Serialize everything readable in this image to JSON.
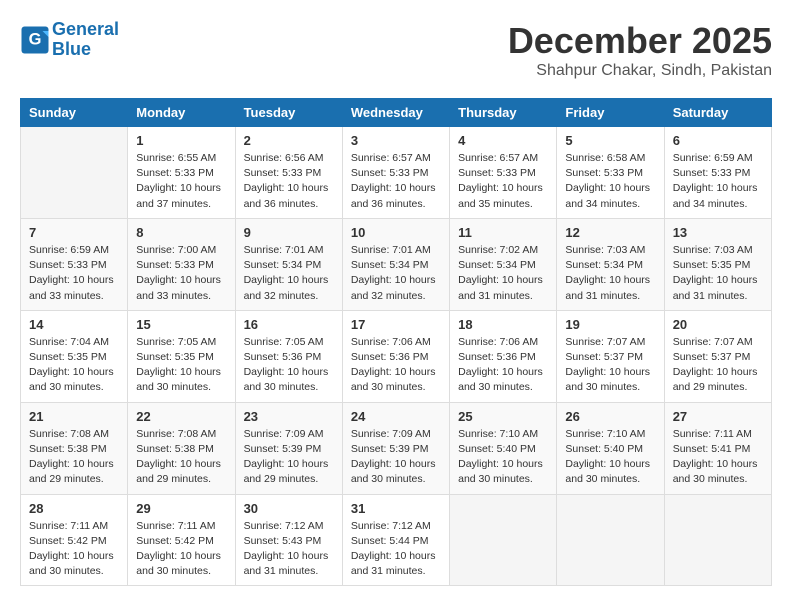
{
  "logo": {
    "line1": "General",
    "line2": "Blue"
  },
  "title": "December 2025",
  "subtitle": "Shahpur Chakar, Sindh, Pakistan",
  "days_header": [
    "Sunday",
    "Monday",
    "Tuesday",
    "Wednesday",
    "Thursday",
    "Friday",
    "Saturday"
  ],
  "weeks": [
    [
      {
        "day": "",
        "info": ""
      },
      {
        "day": "1",
        "info": "Sunrise: 6:55 AM\nSunset: 5:33 PM\nDaylight: 10 hours\nand 37 minutes."
      },
      {
        "day": "2",
        "info": "Sunrise: 6:56 AM\nSunset: 5:33 PM\nDaylight: 10 hours\nand 36 minutes."
      },
      {
        "day": "3",
        "info": "Sunrise: 6:57 AM\nSunset: 5:33 PM\nDaylight: 10 hours\nand 36 minutes."
      },
      {
        "day": "4",
        "info": "Sunrise: 6:57 AM\nSunset: 5:33 PM\nDaylight: 10 hours\nand 35 minutes."
      },
      {
        "day": "5",
        "info": "Sunrise: 6:58 AM\nSunset: 5:33 PM\nDaylight: 10 hours\nand 34 minutes."
      },
      {
        "day": "6",
        "info": "Sunrise: 6:59 AM\nSunset: 5:33 PM\nDaylight: 10 hours\nand 34 minutes."
      }
    ],
    [
      {
        "day": "7",
        "info": "Sunrise: 6:59 AM\nSunset: 5:33 PM\nDaylight: 10 hours\nand 33 minutes."
      },
      {
        "day": "8",
        "info": "Sunrise: 7:00 AM\nSunset: 5:33 PM\nDaylight: 10 hours\nand 33 minutes."
      },
      {
        "day": "9",
        "info": "Sunrise: 7:01 AM\nSunset: 5:34 PM\nDaylight: 10 hours\nand 32 minutes."
      },
      {
        "day": "10",
        "info": "Sunrise: 7:01 AM\nSunset: 5:34 PM\nDaylight: 10 hours\nand 32 minutes."
      },
      {
        "day": "11",
        "info": "Sunrise: 7:02 AM\nSunset: 5:34 PM\nDaylight: 10 hours\nand 31 minutes."
      },
      {
        "day": "12",
        "info": "Sunrise: 7:03 AM\nSunset: 5:34 PM\nDaylight: 10 hours\nand 31 minutes."
      },
      {
        "day": "13",
        "info": "Sunrise: 7:03 AM\nSunset: 5:35 PM\nDaylight: 10 hours\nand 31 minutes."
      }
    ],
    [
      {
        "day": "14",
        "info": "Sunrise: 7:04 AM\nSunset: 5:35 PM\nDaylight: 10 hours\nand 30 minutes."
      },
      {
        "day": "15",
        "info": "Sunrise: 7:05 AM\nSunset: 5:35 PM\nDaylight: 10 hours\nand 30 minutes."
      },
      {
        "day": "16",
        "info": "Sunrise: 7:05 AM\nSunset: 5:36 PM\nDaylight: 10 hours\nand 30 minutes."
      },
      {
        "day": "17",
        "info": "Sunrise: 7:06 AM\nSunset: 5:36 PM\nDaylight: 10 hours\nand 30 minutes."
      },
      {
        "day": "18",
        "info": "Sunrise: 7:06 AM\nSunset: 5:36 PM\nDaylight: 10 hours\nand 30 minutes."
      },
      {
        "day": "19",
        "info": "Sunrise: 7:07 AM\nSunset: 5:37 PM\nDaylight: 10 hours\nand 30 minutes."
      },
      {
        "day": "20",
        "info": "Sunrise: 7:07 AM\nSunset: 5:37 PM\nDaylight: 10 hours\nand 29 minutes."
      }
    ],
    [
      {
        "day": "21",
        "info": "Sunrise: 7:08 AM\nSunset: 5:38 PM\nDaylight: 10 hours\nand 29 minutes."
      },
      {
        "day": "22",
        "info": "Sunrise: 7:08 AM\nSunset: 5:38 PM\nDaylight: 10 hours\nand 29 minutes."
      },
      {
        "day": "23",
        "info": "Sunrise: 7:09 AM\nSunset: 5:39 PM\nDaylight: 10 hours\nand 29 minutes."
      },
      {
        "day": "24",
        "info": "Sunrise: 7:09 AM\nSunset: 5:39 PM\nDaylight: 10 hours\nand 30 minutes."
      },
      {
        "day": "25",
        "info": "Sunrise: 7:10 AM\nSunset: 5:40 PM\nDaylight: 10 hours\nand 30 minutes."
      },
      {
        "day": "26",
        "info": "Sunrise: 7:10 AM\nSunset: 5:40 PM\nDaylight: 10 hours\nand 30 minutes."
      },
      {
        "day": "27",
        "info": "Sunrise: 7:11 AM\nSunset: 5:41 PM\nDaylight: 10 hours\nand 30 minutes."
      }
    ],
    [
      {
        "day": "28",
        "info": "Sunrise: 7:11 AM\nSunset: 5:42 PM\nDaylight: 10 hours\nand 30 minutes."
      },
      {
        "day": "29",
        "info": "Sunrise: 7:11 AM\nSunset: 5:42 PM\nDaylight: 10 hours\nand 30 minutes."
      },
      {
        "day": "30",
        "info": "Sunrise: 7:12 AM\nSunset: 5:43 PM\nDaylight: 10 hours\nand 31 minutes."
      },
      {
        "day": "31",
        "info": "Sunrise: 7:12 AM\nSunset: 5:44 PM\nDaylight: 10 hours\nand 31 minutes."
      },
      {
        "day": "",
        "info": ""
      },
      {
        "day": "",
        "info": ""
      },
      {
        "day": "",
        "info": ""
      }
    ]
  ]
}
